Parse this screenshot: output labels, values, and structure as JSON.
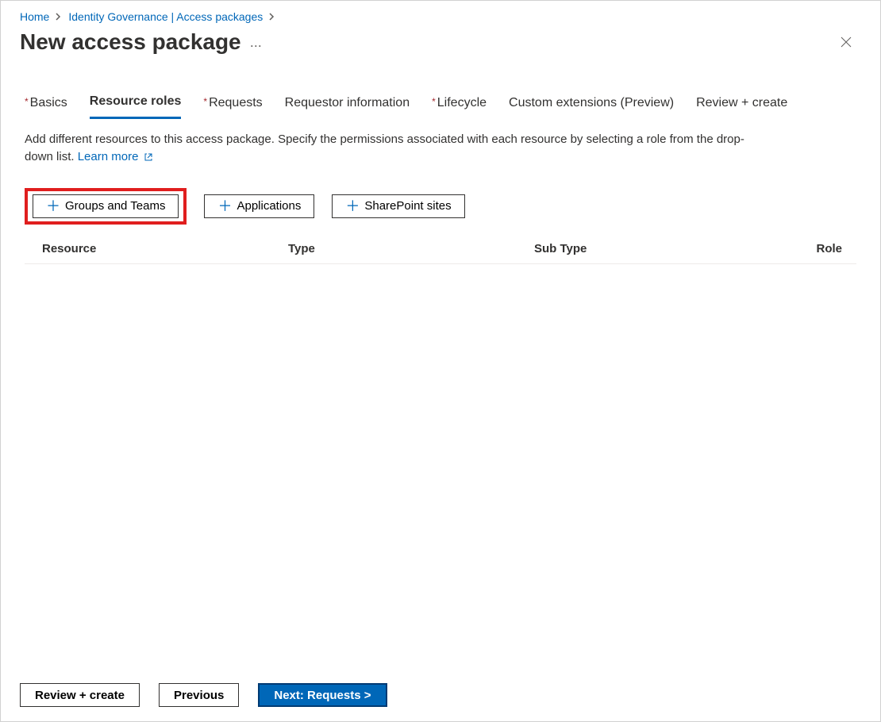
{
  "breadcrumb": {
    "home": "Home",
    "path": "Identity Governance | Access packages"
  },
  "title": "New access package",
  "tabs": [
    {
      "label": "Basics",
      "required": true,
      "active": false
    },
    {
      "label": "Resource roles",
      "required": false,
      "active": true
    },
    {
      "label": "Requests",
      "required": true,
      "active": false
    },
    {
      "label": "Requestor information",
      "required": false,
      "active": false
    },
    {
      "label": "Lifecycle",
      "required": true,
      "active": false
    },
    {
      "label": "Custom extensions (Preview)",
      "required": false,
      "active": false
    },
    {
      "label": "Review + create",
      "required": false,
      "active": false
    }
  ],
  "description": {
    "text": "Add different resources to this access package. Specify the permissions associated with each resource by selecting a role from the drop-down list.",
    "learn_more": "Learn more"
  },
  "resource_buttons": {
    "groups_teams": "Groups and Teams",
    "applications": "Applications",
    "sharepoint": "SharePoint sites"
  },
  "table": {
    "headers": {
      "resource": "Resource",
      "type": "Type",
      "subtype": "Sub Type",
      "role": "Role"
    },
    "rows": []
  },
  "footer": {
    "review_create": "Review + create",
    "previous": "Previous",
    "next": "Next: Requests >"
  }
}
